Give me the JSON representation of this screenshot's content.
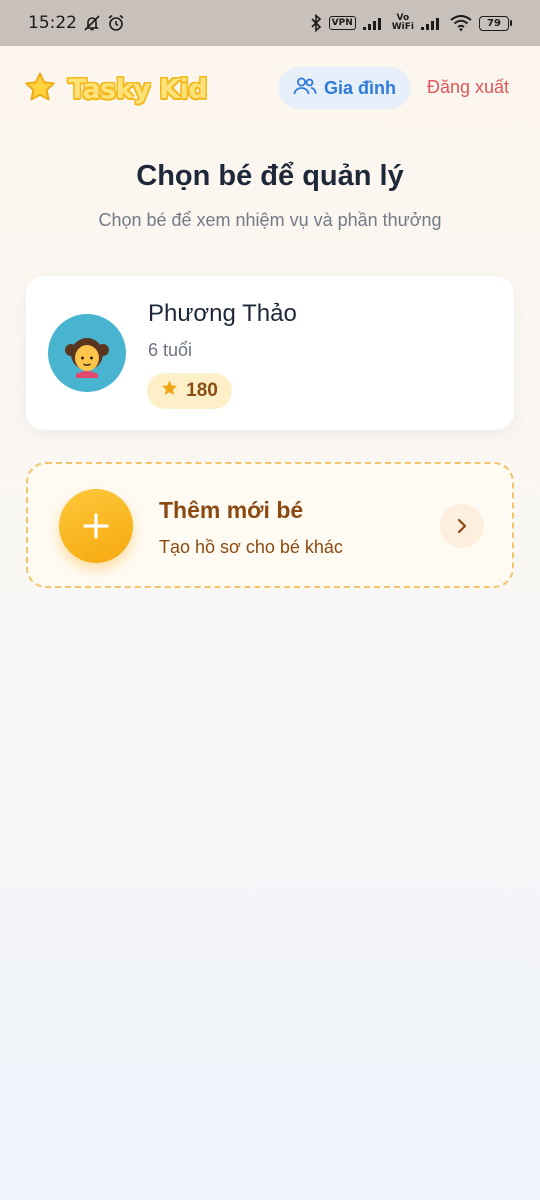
{
  "status_bar": {
    "time": "15:22",
    "vpn_label": "VPN",
    "vowifi_top": "Vo",
    "vowifi_bottom": "WiFi",
    "battery": "79",
    "icons": [
      "mute-bell-icon",
      "alarm-icon",
      "bluetooth-icon",
      "signal-icon",
      "wifi-icon",
      "battery-icon"
    ]
  },
  "header": {
    "app_name": "Tasky Kid",
    "family_button_label": "Gia đình",
    "logout_label": "Đăng xuất"
  },
  "main": {
    "title": "Chọn bé để quản lý",
    "subtitle": "Chọn bé để xem nhiệm vụ và phần thưởng"
  },
  "kids": [
    {
      "name": "Phương Thảo",
      "age": "6 tuổi",
      "points": "180",
      "avatar_icon": "girl-avatar-icon",
      "avatar_color": "#49b4cf"
    }
  ],
  "add_kid": {
    "title": "Thêm mới bé",
    "subtitle": "Tạo hồ sơ cho bé khác"
  },
  "colors": {
    "accent_yellow": "#f6a90f",
    "family_blue": "#2f7bd9",
    "logout_red": "#e0575b",
    "add_brown": "#8a4a12"
  }
}
